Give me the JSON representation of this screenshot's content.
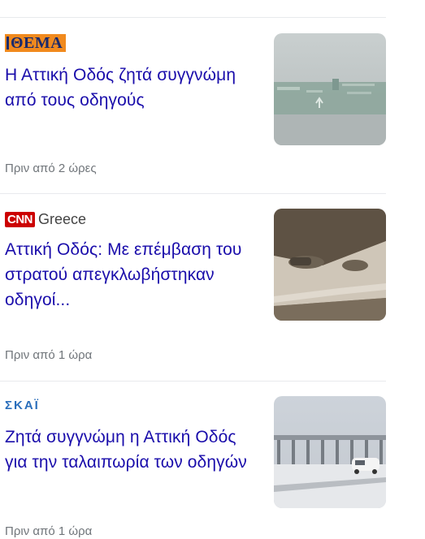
{
  "articles": [
    {
      "source": "ΘΕΜΑ",
      "headline": "Η Αττική Οδός ζητά συγγνώμη από τους οδηγούς",
      "time": "Πριν από 2 ώρες",
      "thumbnail": "road-sign-in-fog-image"
    },
    {
      "source_mark": "CNN",
      "source": "Greece",
      "headline": "Αττική Οδός: Με επέμβαση του στρατού απεγκλωβήστηκαν οδηγοί...",
      "time": "Πριν από 1 ώρα",
      "thumbnail": "snowed-in-cars-image"
    },
    {
      "source": "ΣΚΑΪ",
      "headline": "Ζητά συγγνώμη η Αττική Οδός για την ταλαιπωρία των οδηγών",
      "time": "Πριν από 1 ώρα",
      "thumbnail": "snowy-toll-station-image"
    }
  ],
  "colors": {
    "headline": "#1a0dab",
    "timestamp": "#70757a",
    "divider": "#e8eaed"
  }
}
